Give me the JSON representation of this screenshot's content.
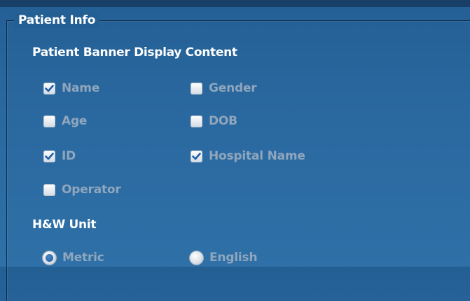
{
  "group": {
    "title": "Patient Info"
  },
  "banner": {
    "label": "Patient Banner Display Content",
    "options": [
      {
        "label": "Name",
        "checked": true
      },
      {
        "label": "Gender",
        "checked": false
      },
      {
        "label": "Age",
        "checked": false
      },
      {
        "label": "DOB",
        "checked": false
      },
      {
        "label": "ID",
        "checked": true
      },
      {
        "label": "Hospital Name",
        "checked": true
      },
      {
        "label": "Operator",
        "checked": false
      }
    ]
  },
  "hw_unit": {
    "label": "H&W Unit",
    "options": [
      {
        "label": "Metric",
        "selected": true
      },
      {
        "label": "English",
        "selected": false
      }
    ]
  },
  "colors": {
    "background": "#2a69a0",
    "check_mark": "#1f5fa8",
    "option_text": "#8fa6bd",
    "heading_text": "#ffffff"
  }
}
